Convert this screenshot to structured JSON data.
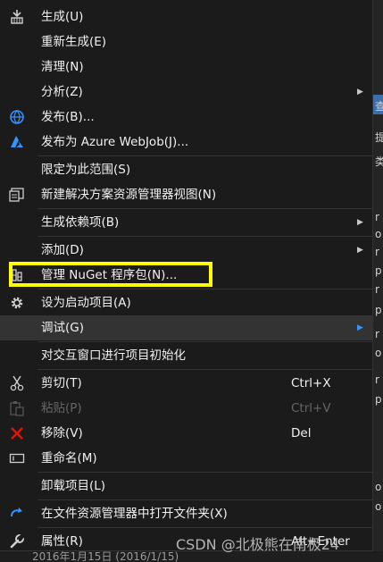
{
  "menu": {
    "items": [
      {
        "label": "生成(U)",
        "icon": "build-icon"
      },
      {
        "label": "重新生成(E)"
      },
      {
        "label": "清理(N)"
      },
      {
        "label": "分析(Z)",
        "submenu": true
      },
      {
        "label": "发布(B)...",
        "icon": "globe-publish-icon"
      },
      {
        "label": "发布为 Azure WebJob(J)...",
        "icon": "azure-icon"
      },
      {
        "label": "限定为此范围(S)"
      },
      {
        "label": "新建解决方案资源管理器视图(N)",
        "icon": "new-view-icon"
      },
      {
        "label": "生成依赖项(B)",
        "submenu": true
      },
      {
        "label": "添加(D)",
        "submenu": true
      },
      {
        "label": "管理 NuGet 程序包(N)...",
        "icon": "nuget-icon"
      },
      {
        "label": "设为启动项目(A)",
        "icon": "gear-icon"
      },
      {
        "label": "调试(G)",
        "submenu": true
      },
      {
        "label": "对交互窗口进行项目初始化"
      },
      {
        "label": "剪切(T)",
        "shortcut": "Ctrl+X",
        "icon": "scissors-icon"
      },
      {
        "label": "粘贴(P)",
        "shortcut": "Ctrl+V",
        "icon": "paste-icon",
        "disabled": true
      },
      {
        "label": "移除(V)",
        "shortcut": "Del",
        "icon": "remove-x-icon"
      },
      {
        "label": "重命名(M)",
        "icon": "rename-icon"
      },
      {
        "label": "卸载项目(L)"
      },
      {
        "label": "在文件资源管理器中打开文件夹(X)",
        "icon": "refresh-arrow-icon"
      },
      {
        "label": "属性(R)",
        "shortcut": "Alt+Enter",
        "icon": "wrench-icon"
      }
    ]
  },
  "background": {
    "bottom_text": "2016年1月15日 (2016/1/15)",
    "side_fragments": [
      "查",
      "提",
      "类",
      "r",
      "o",
      "r",
      "p",
      "r",
      "p",
      "r",
      "o",
      "r",
      "p",
      "o",
      "o"
    ]
  },
  "watermark": "CSDN @北极熊在南极24",
  "colors": {
    "menu_bg": "#1b1b1c",
    "highlight_box": "#ffff00",
    "submenu_arrow_active": "#3794ff",
    "remove_icon": "#e51400",
    "azure_icon": "#3794ff"
  }
}
